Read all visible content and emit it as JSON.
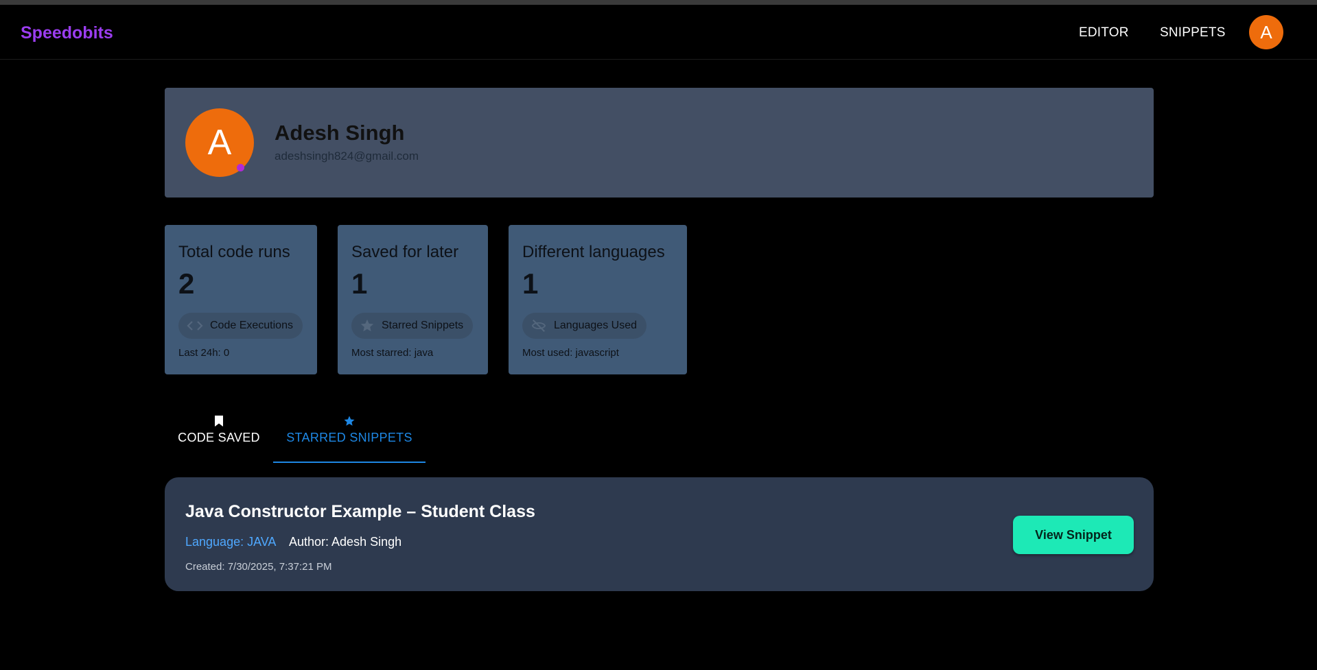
{
  "navbar": {
    "brand": "Speedobits",
    "links": [
      "EDITOR",
      "SNIPPETS"
    ],
    "avatar_letter": "A"
  },
  "profile": {
    "avatar_letter": "A",
    "name": "Adesh Singh",
    "email": "adeshsingh824@gmail.com"
  },
  "stats": [
    {
      "title": "Total code runs",
      "value": "2",
      "chip_icon": "code-icon",
      "chip_label": "Code Executions",
      "footer": "Last 24h: 0"
    },
    {
      "title": "Saved for later",
      "value": "1",
      "chip_icon": "star-icon",
      "chip_label": "Starred Snippets",
      "footer": "Most starred: java"
    },
    {
      "title": "Different languages",
      "value": "1",
      "chip_icon": "eye-off-icon",
      "chip_label": "Languages Used",
      "footer": "Most used: javascript"
    }
  ],
  "tabs": [
    {
      "label": "CODE SAVED",
      "icon": "bookmark-icon",
      "active": false
    },
    {
      "label": "STARRED SNIPPETS",
      "icon": "star-icon",
      "active": true
    }
  ],
  "snippet": {
    "title": "Java Constructor Example – Student Class",
    "language": "Language: JAVA",
    "author": "Author: Adesh Singh",
    "created": "Created: 7/30/2025, 7:37:21 PM",
    "button_label": "View Snippet"
  },
  "colors": {
    "brand": "#9b3df0",
    "avatar": "#ee6c0c",
    "profile_card": "#434f64",
    "stat_card": "#405a77",
    "snippet_card": "#2e3a4f",
    "active_tab": "#1e88e5",
    "button": "#1de9b6"
  }
}
